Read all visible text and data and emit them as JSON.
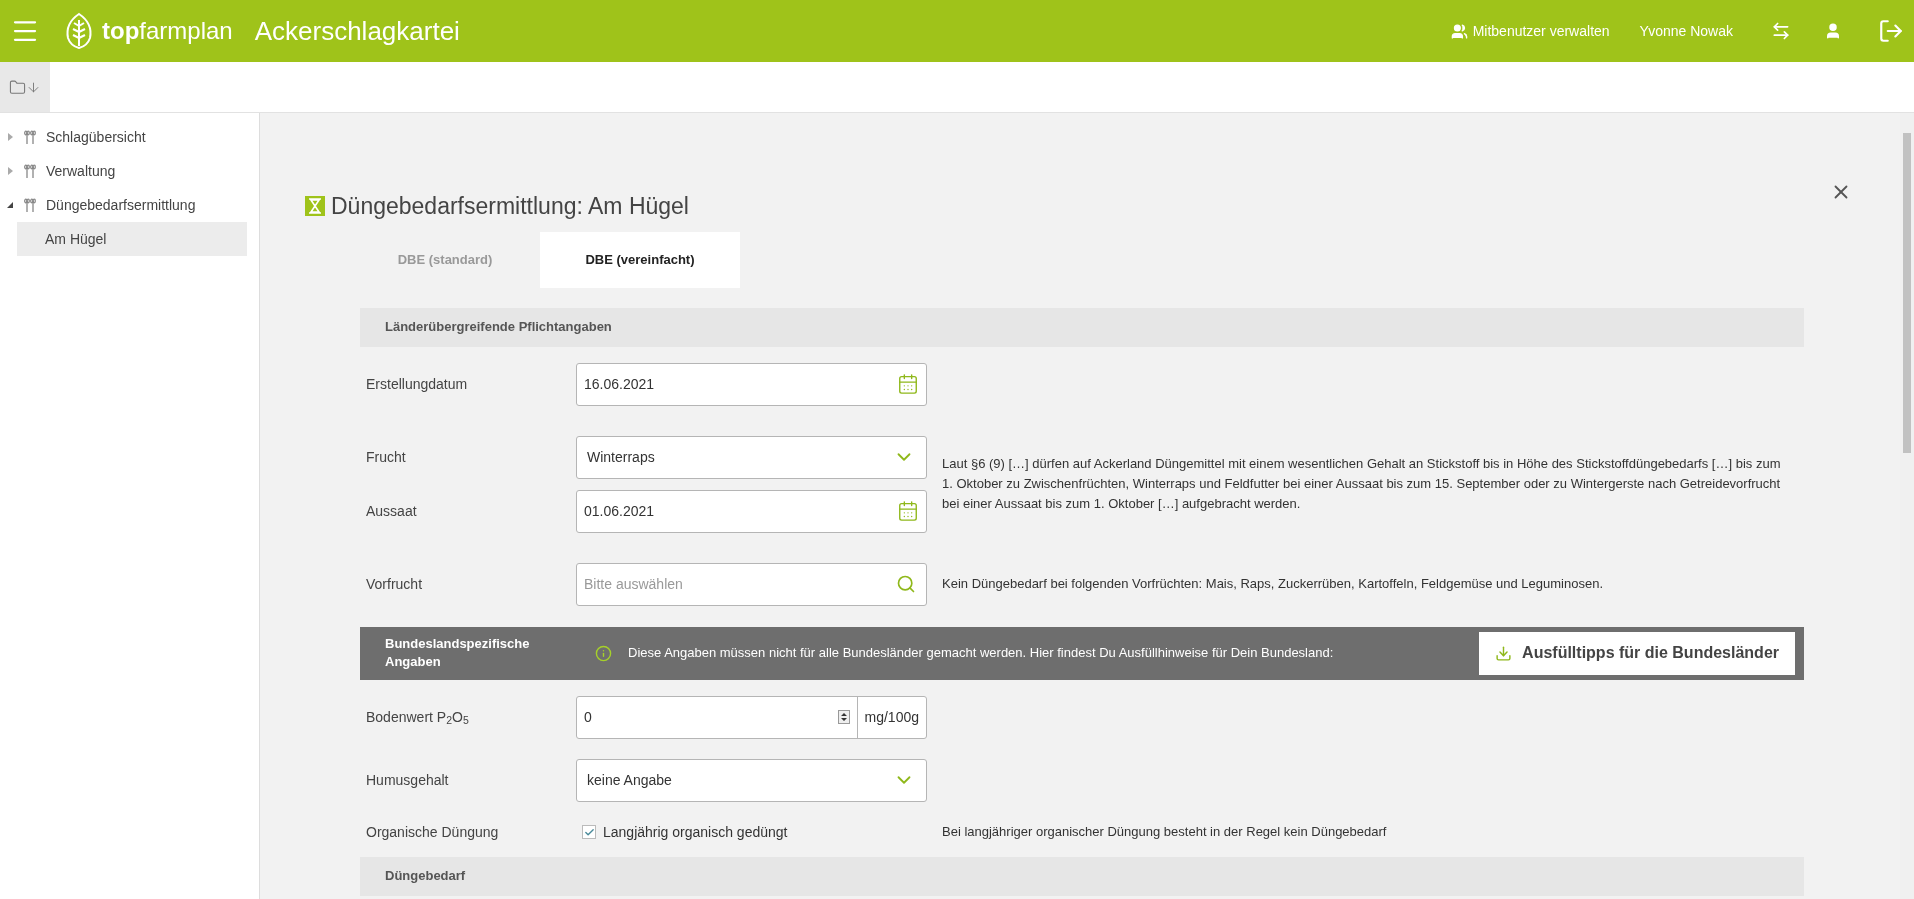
{
  "header": {
    "logo_bold": "top",
    "logo_light": "farmplan",
    "app_title": "Ackerschlagkartei",
    "share_link": "Mitbenutzer verwalten",
    "user_name": "Yvonne Nowak"
  },
  "sidebar": {
    "items": [
      {
        "label": "Schlagübersicht",
        "expanded": false
      },
      {
        "label": "Verwaltung",
        "expanded": false
      },
      {
        "label": "Düngebedarfsermittlung",
        "expanded": true,
        "children": [
          {
            "label": "Am Hügel",
            "selected": true
          }
        ]
      }
    ]
  },
  "page": {
    "title": "Düngebedarfsermittlung: Am Hügel",
    "tabs": [
      {
        "label": "DBE (standard)",
        "selected": false
      },
      {
        "label": "DBE (vereinfacht)",
        "selected": true
      }
    ],
    "section_1": {
      "heading": "Länderübergreifende Pflichtangaben",
      "groups": [
        {
          "rows": [
            {
              "kind": "date",
              "label": "Erstellungdatum",
              "value": "16.06.2021"
            }
          ]
        },
        {
          "rows": [
            {
              "kind": "select",
              "label": "Frucht",
              "value": "Winterraps"
            },
            {
              "kind": "date",
              "label": "Aussaat",
              "value": "01.06.2021"
            }
          ],
          "note": "Laut §6 (9) […] dürfen auf Ackerland Düngemittel mit einem wesentlichen Gehalt an Stickstoff bis in Höhe des Stickstoffdüngebedarfs […] bis zum 1. Oktober zu Zwischenfrüchten, Winterraps und Feldfutter bei einer Aussaat bis zum 15. September oder zu Wintergerste nach Getreidevorfrucht bei einer Aussaat bis zum 1. Oktober […] aufgebracht werden."
        },
        {
          "rows": [
            {
              "kind": "search",
              "label": "Vorfrucht",
              "placeholder": "Bitte auswählen"
            }
          ],
          "note": "Kein Düngebedarf bei folgenden Vorfrüchten: Mais, Raps, Zuckerrüben, Kartoffeln, Feldgemüse und Leguminosen."
        }
      ]
    },
    "section_2": {
      "heading": "Bundeslandspezifische Angaben",
      "info": "Diese Angaben müssen nicht für alle Bundesländer gemacht werden. Hier findest Du Ausfüllhinweise für Dein Bundesland:",
      "button": "Ausfülltipps für die Bundesländer",
      "rows": [
        {
          "kind": "number",
          "label": "Bodenwert P$_{2}$O$_{5}$",
          "value": "0",
          "unit": "mg/100g"
        },
        {
          "kind": "select",
          "label": "Humusgehalt",
          "value": "keine Angabe"
        },
        {
          "kind": "checkbox",
          "label": "Organische Düngung",
          "checkbox_label": "Langjährig organisch gedüngt",
          "checked": true,
          "note": "Bei langjähriger organischer Düngung besteht in der Regel kein Düngebedarf"
        }
      ]
    },
    "section_3": {
      "heading": "Düngebedarf"
    }
  }
}
